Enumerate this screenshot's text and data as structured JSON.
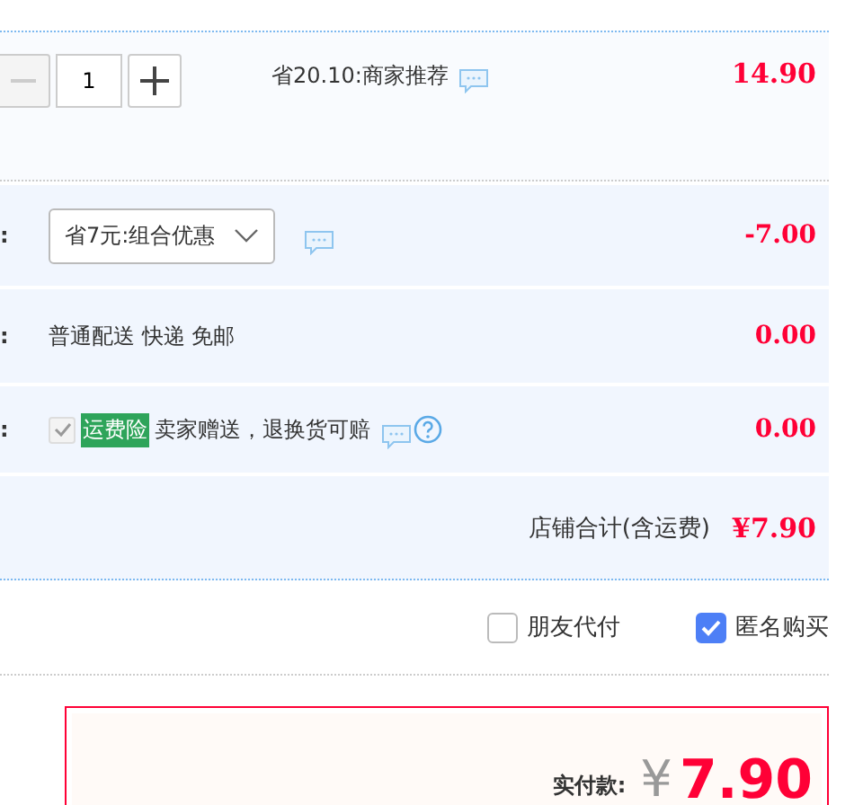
{
  "item": {
    "quantity": "1",
    "minus_disabled": true,
    "promo": "省20.10:商家推荐",
    "price": "14.90"
  },
  "rows": [
    {
      "kind": "select",
      "label": ":",
      "value": "省7元:组合优惠",
      "amount": "-7.00"
    },
    {
      "kind": "text",
      "label": ":",
      "value": "普通配送 快递 免邮",
      "amount": "0.00"
    },
    {
      "kind": "insurance",
      "label": ":",
      "checked": true,
      "disabled": true,
      "tag": "运费险",
      "value": "卖家赠送，退换货可赔",
      "amount": "0.00"
    }
  ],
  "shop_total": {
    "label": "店铺合计(含运费)",
    "amount": "¥7.90"
  },
  "options": [
    {
      "label": "朋友代付",
      "checked": false
    },
    {
      "label": "匿名购买",
      "checked": true
    }
  ],
  "payment": {
    "label": "实付款:",
    "currency": "¥",
    "amount": "7.90"
  }
}
